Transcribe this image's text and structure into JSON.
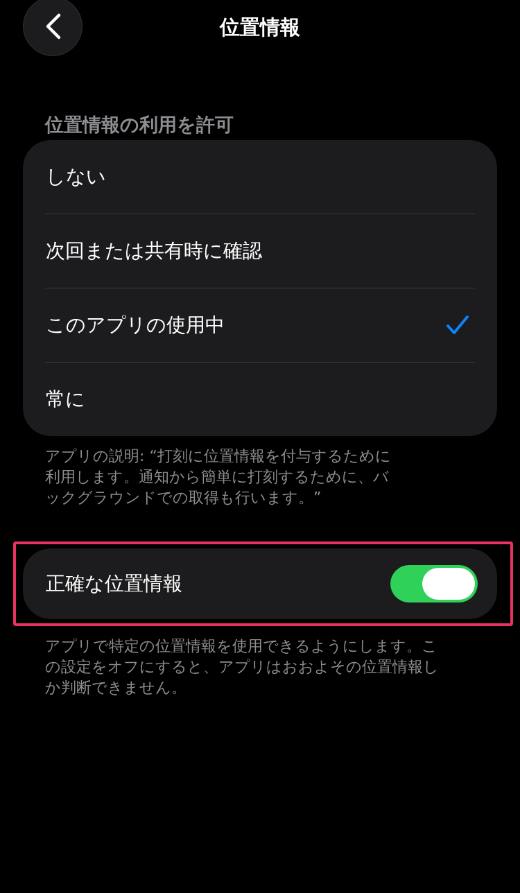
{
  "header": {
    "title": "位置情報"
  },
  "section_title": "位置情報の利用を許可",
  "options": [
    {
      "label": "しない",
      "selected": false
    },
    {
      "label": "次回または共有時に確認",
      "selected": false
    },
    {
      "label": "このアプリの使用中",
      "selected": true
    },
    {
      "label": "常に",
      "selected": false
    }
  ],
  "options_footer": "アプリの説明: “打刻に位置情報を付与するために利用します。通知から簡単に打刻するために、バックグラウンドでの取得も行います。”",
  "precise_location": {
    "label": "正確な位置情報",
    "on": true,
    "highlighted": true
  },
  "precise_footer": "アプリで特定の位置情報を使用できるようにします。この設定をオフにすると、アプリはおおよその位置情報しか判断できません。"
}
